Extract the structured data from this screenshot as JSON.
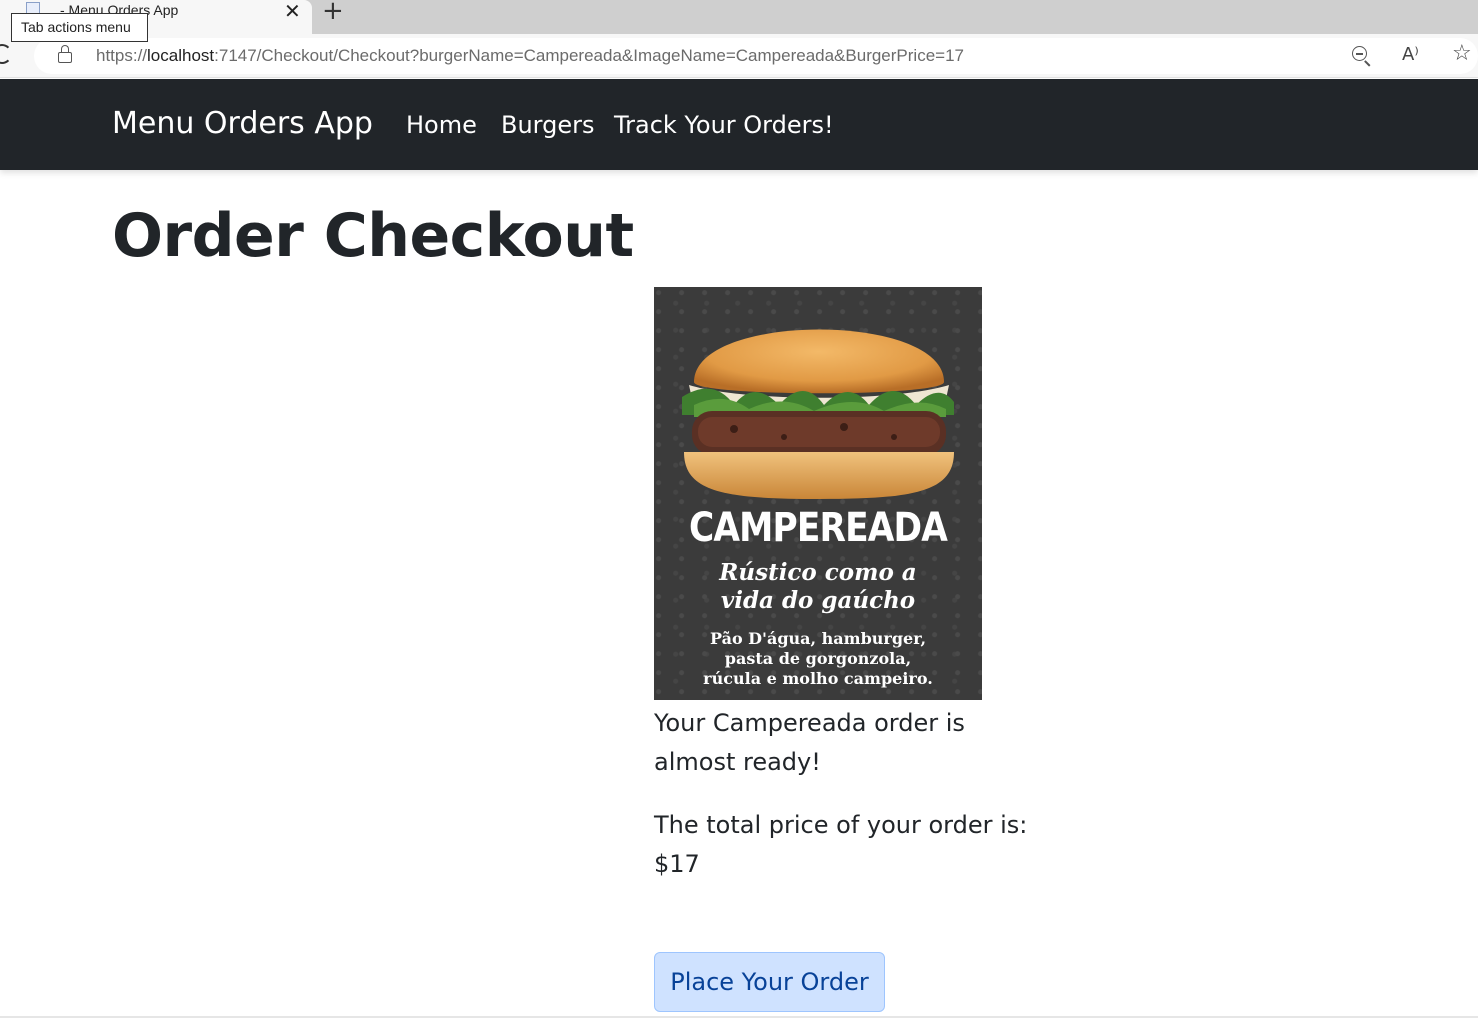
{
  "browser": {
    "tab_title": "- Menu Orders App",
    "tooltip": "Tab actions menu",
    "new_tab_label": "+",
    "close_label": "✕",
    "url_scheme": "https://",
    "url_host": "localhost",
    "url_rest": ":7147/Checkout/Checkout?burgerName=Campereada&ImageName=Campereada&BurgerPrice=17",
    "icons": [
      "reload-icon",
      "lock-icon",
      "zoom-out-icon",
      "read-aloud-icon",
      "favorite-star-icon"
    ]
  },
  "navbar": {
    "brand": "Menu Orders App",
    "links": [
      "Home",
      "Burgers",
      "Track Your Orders!"
    ],
    "background": "#212529"
  },
  "page": {
    "title": "Order Checkout"
  },
  "burger_image": {
    "title": "CAMPEREADA",
    "tagline_line1": "Rústico como a",
    "tagline_line2": "vida do gaúcho",
    "ingredients_line1": "Pão D'água, hamburger,",
    "ingredients_line2": "pasta de gorgonzola,",
    "ingredients_line3": "rúcula e molho campeiro."
  },
  "order": {
    "message": "Your Campereada order is almost ready!",
    "price_message": "The total price of your order is: $17"
  },
  "actions": {
    "place_order": "Place Your Order",
    "button_color": "#cfe2ff"
  }
}
